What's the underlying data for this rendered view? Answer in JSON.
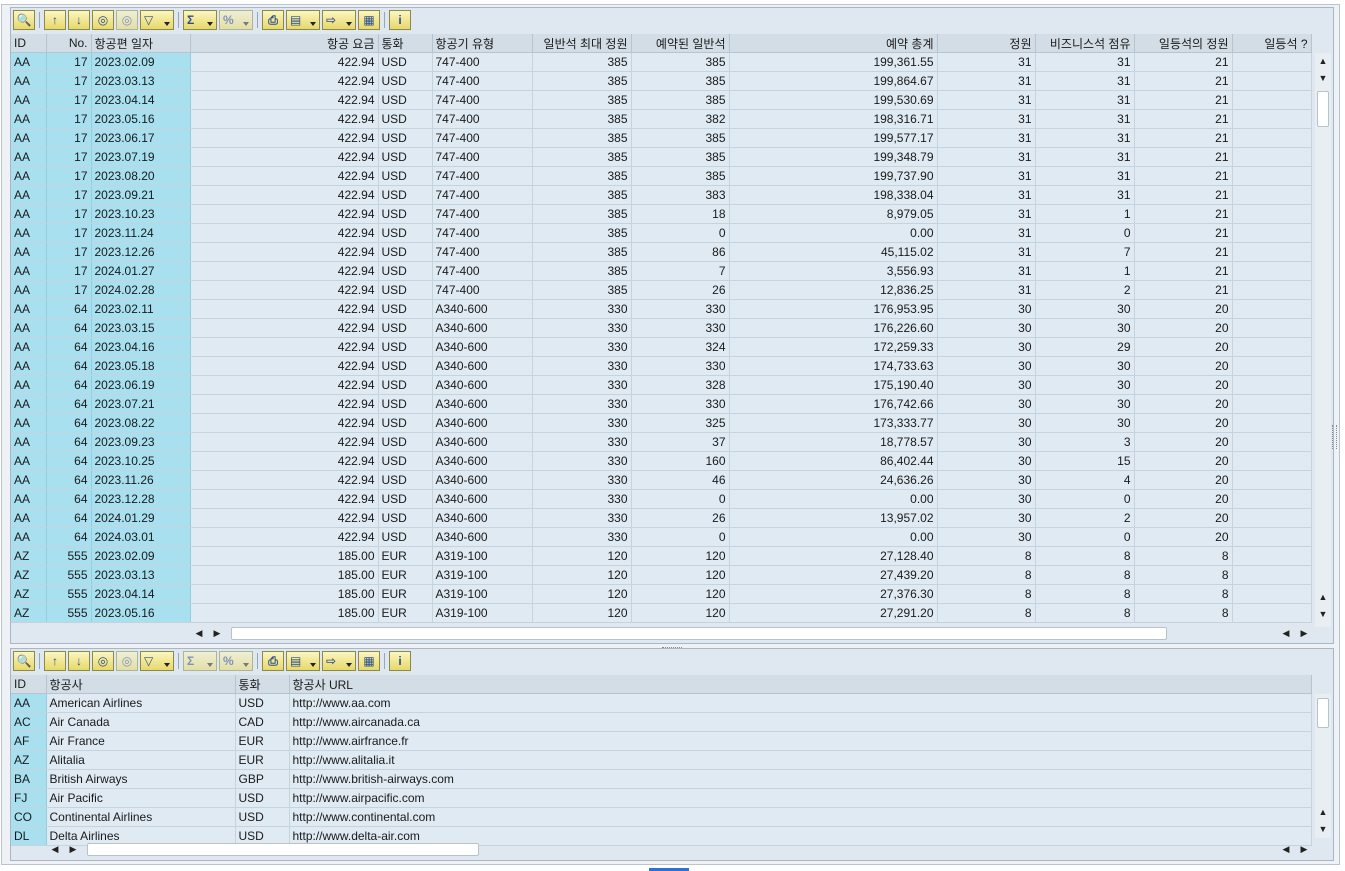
{
  "toolbar_icons": [
    "details-icon",
    "sort-ascending-icon",
    "sort-descending-icon",
    "find-icon",
    "find-next-icon",
    "filter-icon",
    "sum-icon",
    "subtotals-icon",
    "print-icon",
    "views-icon",
    "export-icon",
    "layout-icon",
    "info-icon"
  ],
  "top_grid": {
    "columns": [
      "ID",
      "No.",
      "항공편 일자",
      "항공 요금",
      "통화",
      "항공기 유형",
      "일반석 최대 정원",
      "예약된 일반석",
      "예약 총계",
      "정원",
      "비즈니스석 점유",
      "일등석의 정원",
      "일등석 ?"
    ],
    "rows": [
      [
        "AA",
        "17",
        "2023.02.09",
        "422.94",
        "USD",
        "747-400",
        "385",
        "385",
        "199,361.55",
        "31",
        "31",
        "21",
        ""
      ],
      [
        "AA",
        "17",
        "2023.03.13",
        "422.94",
        "USD",
        "747-400",
        "385",
        "385",
        "199,864.67",
        "31",
        "31",
        "21",
        ""
      ],
      [
        "AA",
        "17",
        "2023.04.14",
        "422.94",
        "USD",
        "747-400",
        "385",
        "385",
        "199,530.69",
        "31",
        "31",
        "21",
        ""
      ],
      [
        "AA",
        "17",
        "2023.05.16",
        "422.94",
        "USD",
        "747-400",
        "385",
        "382",
        "198,316.71",
        "31",
        "31",
        "21",
        ""
      ],
      [
        "AA",
        "17",
        "2023.06.17",
        "422.94",
        "USD",
        "747-400",
        "385",
        "385",
        "199,577.17",
        "31",
        "31",
        "21",
        ""
      ],
      [
        "AA",
        "17",
        "2023.07.19",
        "422.94",
        "USD",
        "747-400",
        "385",
        "385",
        "199,348.79",
        "31",
        "31",
        "21",
        ""
      ],
      [
        "AA",
        "17",
        "2023.08.20",
        "422.94",
        "USD",
        "747-400",
        "385",
        "385",
        "199,737.90",
        "31",
        "31",
        "21",
        ""
      ],
      [
        "AA",
        "17",
        "2023.09.21",
        "422.94",
        "USD",
        "747-400",
        "385",
        "383",
        "198,338.04",
        "31",
        "31",
        "21",
        ""
      ],
      [
        "AA",
        "17",
        "2023.10.23",
        "422.94",
        "USD",
        "747-400",
        "385",
        "18",
        "8,979.05",
        "31",
        "1",
        "21",
        ""
      ],
      [
        "AA",
        "17",
        "2023.11.24",
        "422.94",
        "USD",
        "747-400",
        "385",
        "0",
        "0.00",
        "31",
        "0",
        "21",
        ""
      ],
      [
        "AA",
        "17",
        "2023.12.26",
        "422.94",
        "USD",
        "747-400",
        "385",
        "86",
        "45,115.02",
        "31",
        "7",
        "21",
        ""
      ],
      [
        "AA",
        "17",
        "2024.01.27",
        "422.94",
        "USD",
        "747-400",
        "385",
        "7",
        "3,556.93",
        "31",
        "1",
        "21",
        ""
      ],
      [
        "AA",
        "17",
        "2024.02.28",
        "422.94",
        "USD",
        "747-400",
        "385",
        "26",
        "12,836.25",
        "31",
        "2",
        "21",
        ""
      ],
      [
        "AA",
        "64",
        "2023.02.11",
        "422.94",
        "USD",
        "A340-600",
        "330",
        "330",
        "176,953.95",
        "30",
        "30",
        "20",
        ""
      ],
      [
        "AA",
        "64",
        "2023.03.15",
        "422.94",
        "USD",
        "A340-600",
        "330",
        "330",
        "176,226.60",
        "30",
        "30",
        "20",
        ""
      ],
      [
        "AA",
        "64",
        "2023.04.16",
        "422.94",
        "USD",
        "A340-600",
        "330",
        "324",
        "172,259.33",
        "30",
        "29",
        "20",
        ""
      ],
      [
        "AA",
        "64",
        "2023.05.18",
        "422.94",
        "USD",
        "A340-600",
        "330",
        "330",
        "174,733.63",
        "30",
        "30",
        "20",
        ""
      ],
      [
        "AA",
        "64",
        "2023.06.19",
        "422.94",
        "USD",
        "A340-600",
        "330",
        "328",
        "175,190.40",
        "30",
        "30",
        "20",
        ""
      ],
      [
        "AA",
        "64",
        "2023.07.21",
        "422.94",
        "USD",
        "A340-600",
        "330",
        "330",
        "176,742.66",
        "30",
        "30",
        "20",
        ""
      ],
      [
        "AA",
        "64",
        "2023.08.22",
        "422.94",
        "USD",
        "A340-600",
        "330",
        "325",
        "173,333.77",
        "30",
        "30",
        "20",
        ""
      ],
      [
        "AA",
        "64",
        "2023.09.23",
        "422.94",
        "USD",
        "A340-600",
        "330",
        "37",
        "18,778.57",
        "30",
        "3",
        "20",
        ""
      ],
      [
        "AA",
        "64",
        "2023.10.25",
        "422.94",
        "USD",
        "A340-600",
        "330",
        "160",
        "86,402.44",
        "30",
        "15",
        "20",
        ""
      ],
      [
        "AA",
        "64",
        "2023.11.26",
        "422.94",
        "USD",
        "A340-600",
        "330",
        "46",
        "24,636.26",
        "30",
        "4",
        "20",
        ""
      ],
      [
        "AA",
        "64",
        "2023.12.28",
        "422.94",
        "USD",
        "A340-600",
        "330",
        "0",
        "0.00",
        "30",
        "0",
        "20",
        ""
      ],
      [
        "AA",
        "64",
        "2024.01.29",
        "422.94",
        "USD",
        "A340-600",
        "330",
        "26",
        "13,957.02",
        "30",
        "2",
        "20",
        ""
      ],
      [
        "AA",
        "64",
        "2024.03.01",
        "422.94",
        "USD",
        "A340-600",
        "330",
        "0",
        "0.00",
        "30",
        "0",
        "20",
        ""
      ],
      [
        "AZ",
        "555",
        "2023.02.09",
        "185.00",
        "EUR",
        "A319-100",
        "120",
        "120",
        "27,128.40",
        "8",
        "8",
        "8",
        ""
      ],
      [
        "AZ",
        "555",
        "2023.03.13",
        "185.00",
        "EUR",
        "A319-100",
        "120",
        "120",
        "27,439.20",
        "8",
        "8",
        "8",
        ""
      ],
      [
        "AZ",
        "555",
        "2023.04.14",
        "185.00",
        "EUR",
        "A319-100",
        "120",
        "120",
        "27,376.30",
        "8",
        "8",
        "8",
        ""
      ],
      [
        "AZ",
        "555",
        "2023.05.16",
        "185.00",
        "EUR",
        "A319-100",
        "120",
        "120",
        "27,291.20",
        "8",
        "8",
        "8",
        ""
      ]
    ]
  },
  "bottom_grid": {
    "columns": [
      "ID",
      "항공사",
      "통화",
      "항공사 URL"
    ],
    "rows": [
      [
        "AA",
        "American Airlines",
        "USD",
        "http://www.aa.com"
      ],
      [
        "AC",
        "Air Canada",
        "CAD",
        "http://www.aircanada.ca"
      ],
      [
        "AF",
        "Air France",
        "EUR",
        "http://www.airfrance.fr"
      ],
      [
        "AZ",
        "Alitalia",
        "EUR",
        "http://www.alitalia.it"
      ],
      [
        "BA",
        "British Airways",
        "GBP",
        "http://www.british-airways.com"
      ],
      [
        "FJ",
        "Air Pacific",
        "USD",
        "http://www.airpacific.com"
      ],
      [
        "CO",
        "Continental Airlines",
        "USD",
        "http://www.continental.com"
      ],
      [
        "DL",
        "Delta Airlines",
        "USD",
        "http://www.delta-air.com"
      ]
    ]
  }
}
